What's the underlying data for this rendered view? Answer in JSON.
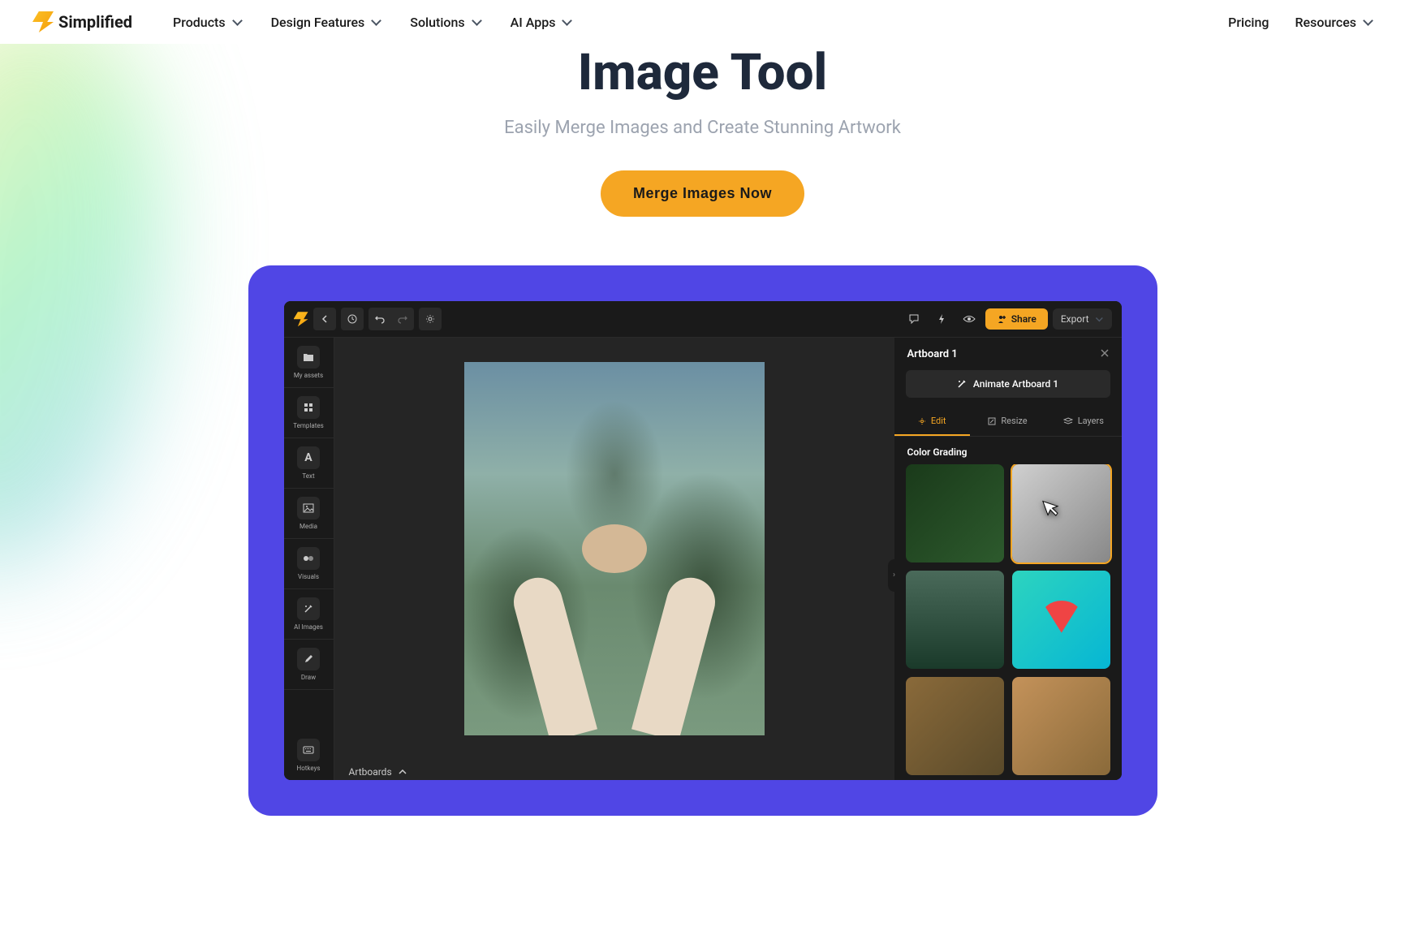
{
  "topnav": {
    "brand": "Simplified",
    "menu": [
      {
        "label": "Products"
      },
      {
        "label": "Design Features"
      },
      {
        "label": "Solutions"
      },
      {
        "label": "AI Apps"
      }
    ],
    "right": {
      "pricing": "Pricing",
      "resources": "Resources"
    }
  },
  "hero": {
    "title": "Image Tool",
    "subtitle": "Easily Merge Images and Create Stunning Artwork",
    "cta": "Merge Images Now"
  },
  "app": {
    "topbar": {
      "share": "Share",
      "export": "Export"
    },
    "sidebar": [
      {
        "icon": "folder",
        "label": "My assets"
      },
      {
        "icon": "grid",
        "label": "Templates"
      },
      {
        "icon": "text",
        "label": "Text"
      },
      {
        "icon": "image",
        "label": "Media"
      },
      {
        "icon": "visuals",
        "label": "Visuals"
      },
      {
        "icon": "wand",
        "label": "AI Images"
      },
      {
        "icon": "pen",
        "label": "Draw"
      }
    ],
    "hotkeys": {
      "icon": "keyboard",
      "label": "Hotkeys"
    },
    "canvas": {
      "footer_label": "Artboards"
    },
    "panel": {
      "title": "Artboard 1",
      "animate": "Animate Artboard 1",
      "tabs": [
        {
          "label": "Edit",
          "active": true
        },
        {
          "label": "Resize",
          "active": false
        },
        {
          "label": "Layers",
          "active": false
        }
      ],
      "section": "Color Grading"
    }
  }
}
